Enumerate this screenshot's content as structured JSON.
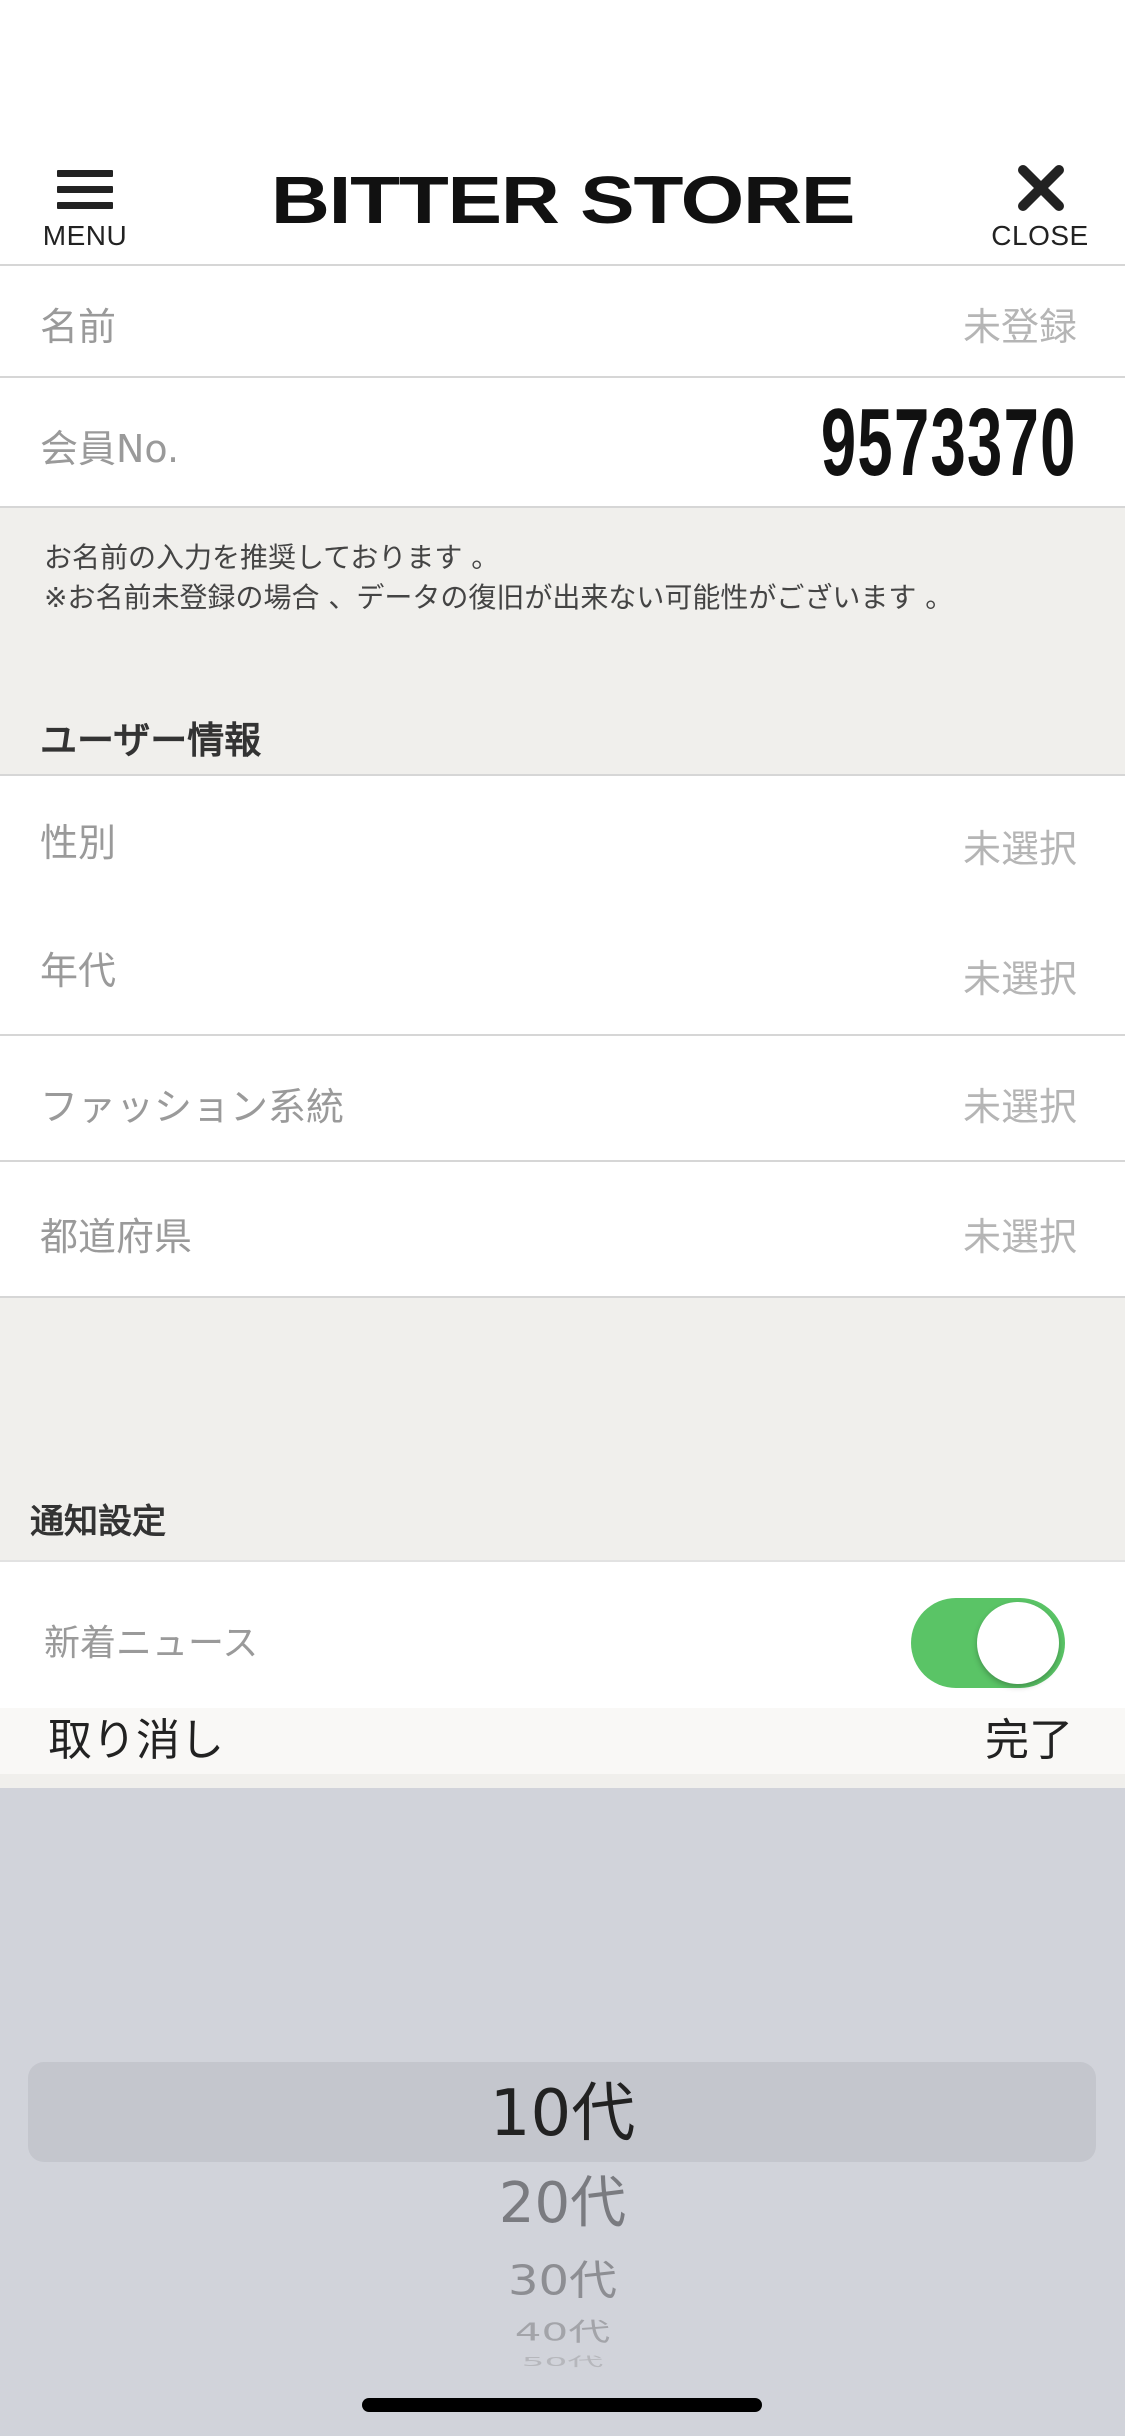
{
  "header": {
    "menu_label": "MENU",
    "logo": "BITTER STORE",
    "close_label": "CLOSE"
  },
  "account": {
    "name_label": "名前",
    "name_value": "未登録",
    "member_label": "会員No.",
    "member_no": "9573370"
  },
  "notice": {
    "line1": "お名前の入力を推奨しております 。",
    "line2": "※お名前未登録の場合 、データの復旧が出来ない可能性がございます 。"
  },
  "user_info": {
    "title": "ユーザー情報",
    "rows": [
      {
        "label": "性別",
        "value": "未選択"
      },
      {
        "label": "年代",
        "value": "未選択"
      },
      {
        "label": "ファッション系統",
        "value": "未選択"
      },
      {
        "label": "都道府県",
        "value": "未選択"
      }
    ]
  },
  "notifications": {
    "title": "通知設定",
    "news_label": "新着ニュース",
    "news_enabled": true,
    "toggle_color": "#5ac466"
  },
  "picker": {
    "cancel_label": "取り消し",
    "done_label": "完了",
    "options": [
      "10代",
      "20代",
      "30代",
      "40代",
      "50代"
    ],
    "selected": "10代"
  }
}
